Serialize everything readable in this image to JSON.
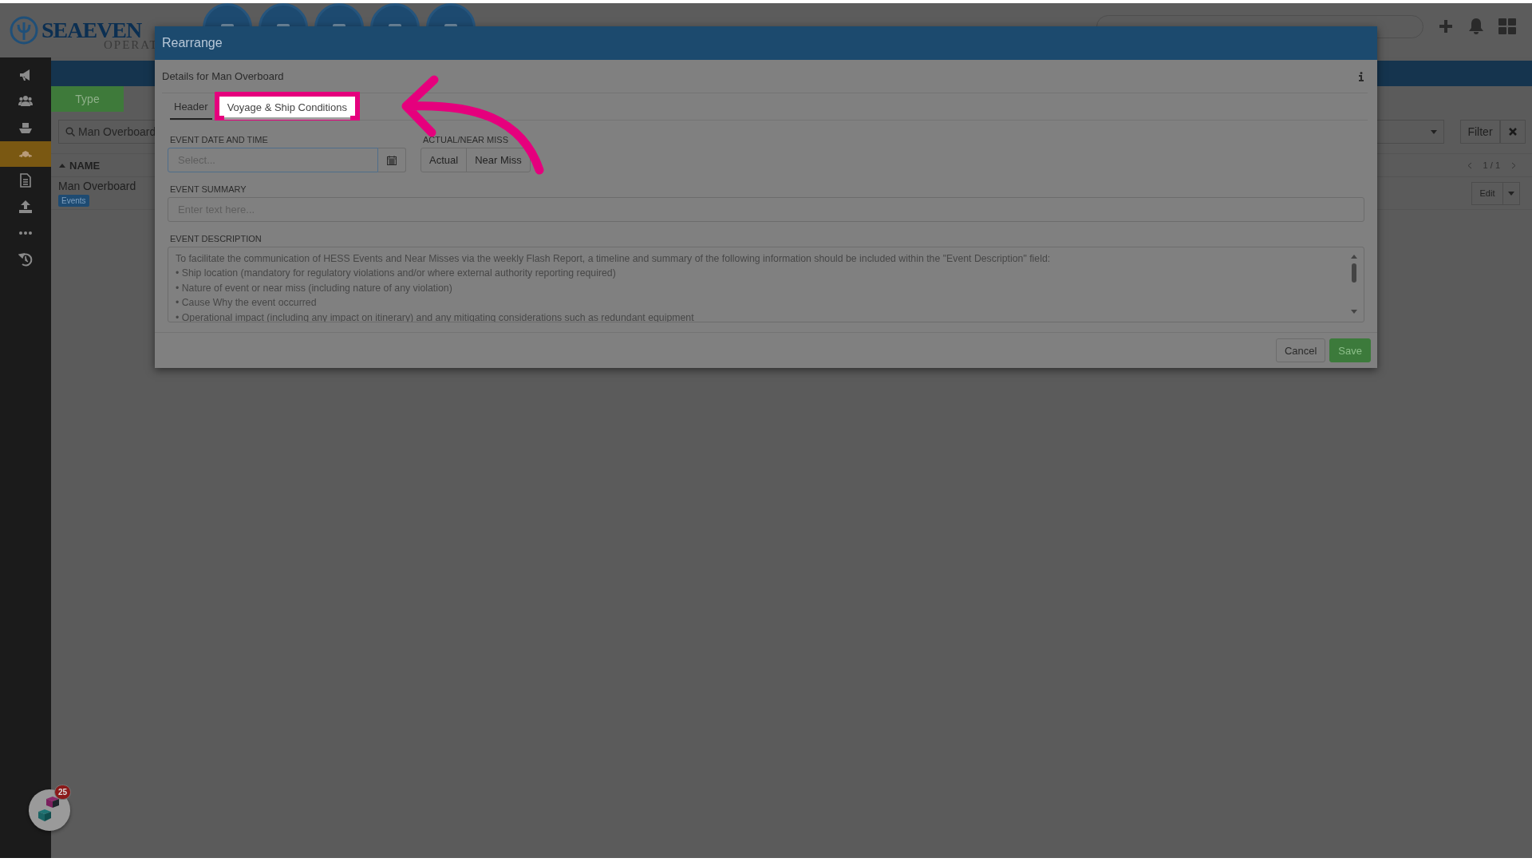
{
  "app_header": {
    "logo": "SEAEVEN",
    "logo_subtitle": "OPERAT"
  },
  "sidebar": {
    "items": [
      {
        "selected": false
      },
      {
        "selected": false
      },
      {
        "selected": false
      },
      {
        "selected": true
      },
      {
        "selected": false
      },
      {
        "selected": false
      },
      {
        "selected": false
      },
      {
        "selected": false
      }
    ]
  },
  "list_view": {
    "type_button": "Type",
    "search_value": "Man Overboard",
    "filter_button": "Filter",
    "columns": [
      {
        "label": "NAME",
        "sorted": true
      }
    ],
    "pagination": "1 / 1",
    "rows": [
      {
        "name": "Man Overboard",
        "tag": "Events",
        "action": "Edit"
      }
    ]
  },
  "modal": {
    "title": "Rearrange",
    "subtitle": "Details for Man Overboard",
    "tabs": [
      {
        "label": "Header",
        "selected": true,
        "highlighted": false
      },
      {
        "label": "Voyage & Ship Conditions",
        "selected": false,
        "highlighted": true
      }
    ],
    "date_field": {
      "label": "EVENT DATE AND TIME",
      "placeholder": "Select..."
    },
    "actual_near_miss": {
      "label": "ACTUAL/NEAR MISS",
      "options": [
        {
          "label": "Actual",
          "selected": false
        },
        {
          "label": "Near Miss",
          "selected": false
        }
      ]
    },
    "summary_field": {
      "label": "EVENT SUMMARY",
      "placeholder": "Enter text here..."
    },
    "description_field": {
      "label": "EVENT DESCRIPTION",
      "value_lines": [
        "To facilitate the communication of HESS Events and Near Misses via the weekly Flash Report, a timeline and summary of the following information should be included within the \"Event Description\" field:",
        "• Ship location (mandatory for regulatory violations and/or where external authority reporting required)",
        "• Nature of event or near miss (including nature of any violation)",
        "• Cause Why the event occurred",
        "• Operational impact (including any impact on itinerary) and any mitigating considerations such as redundant equipment"
      ]
    },
    "buttons": [
      {
        "label": "Cancel",
        "kind": "secondary"
      },
      {
        "label": "Save",
        "kind": "primary"
      }
    ]
  },
  "help_widget": {
    "badge": "25"
  }
}
